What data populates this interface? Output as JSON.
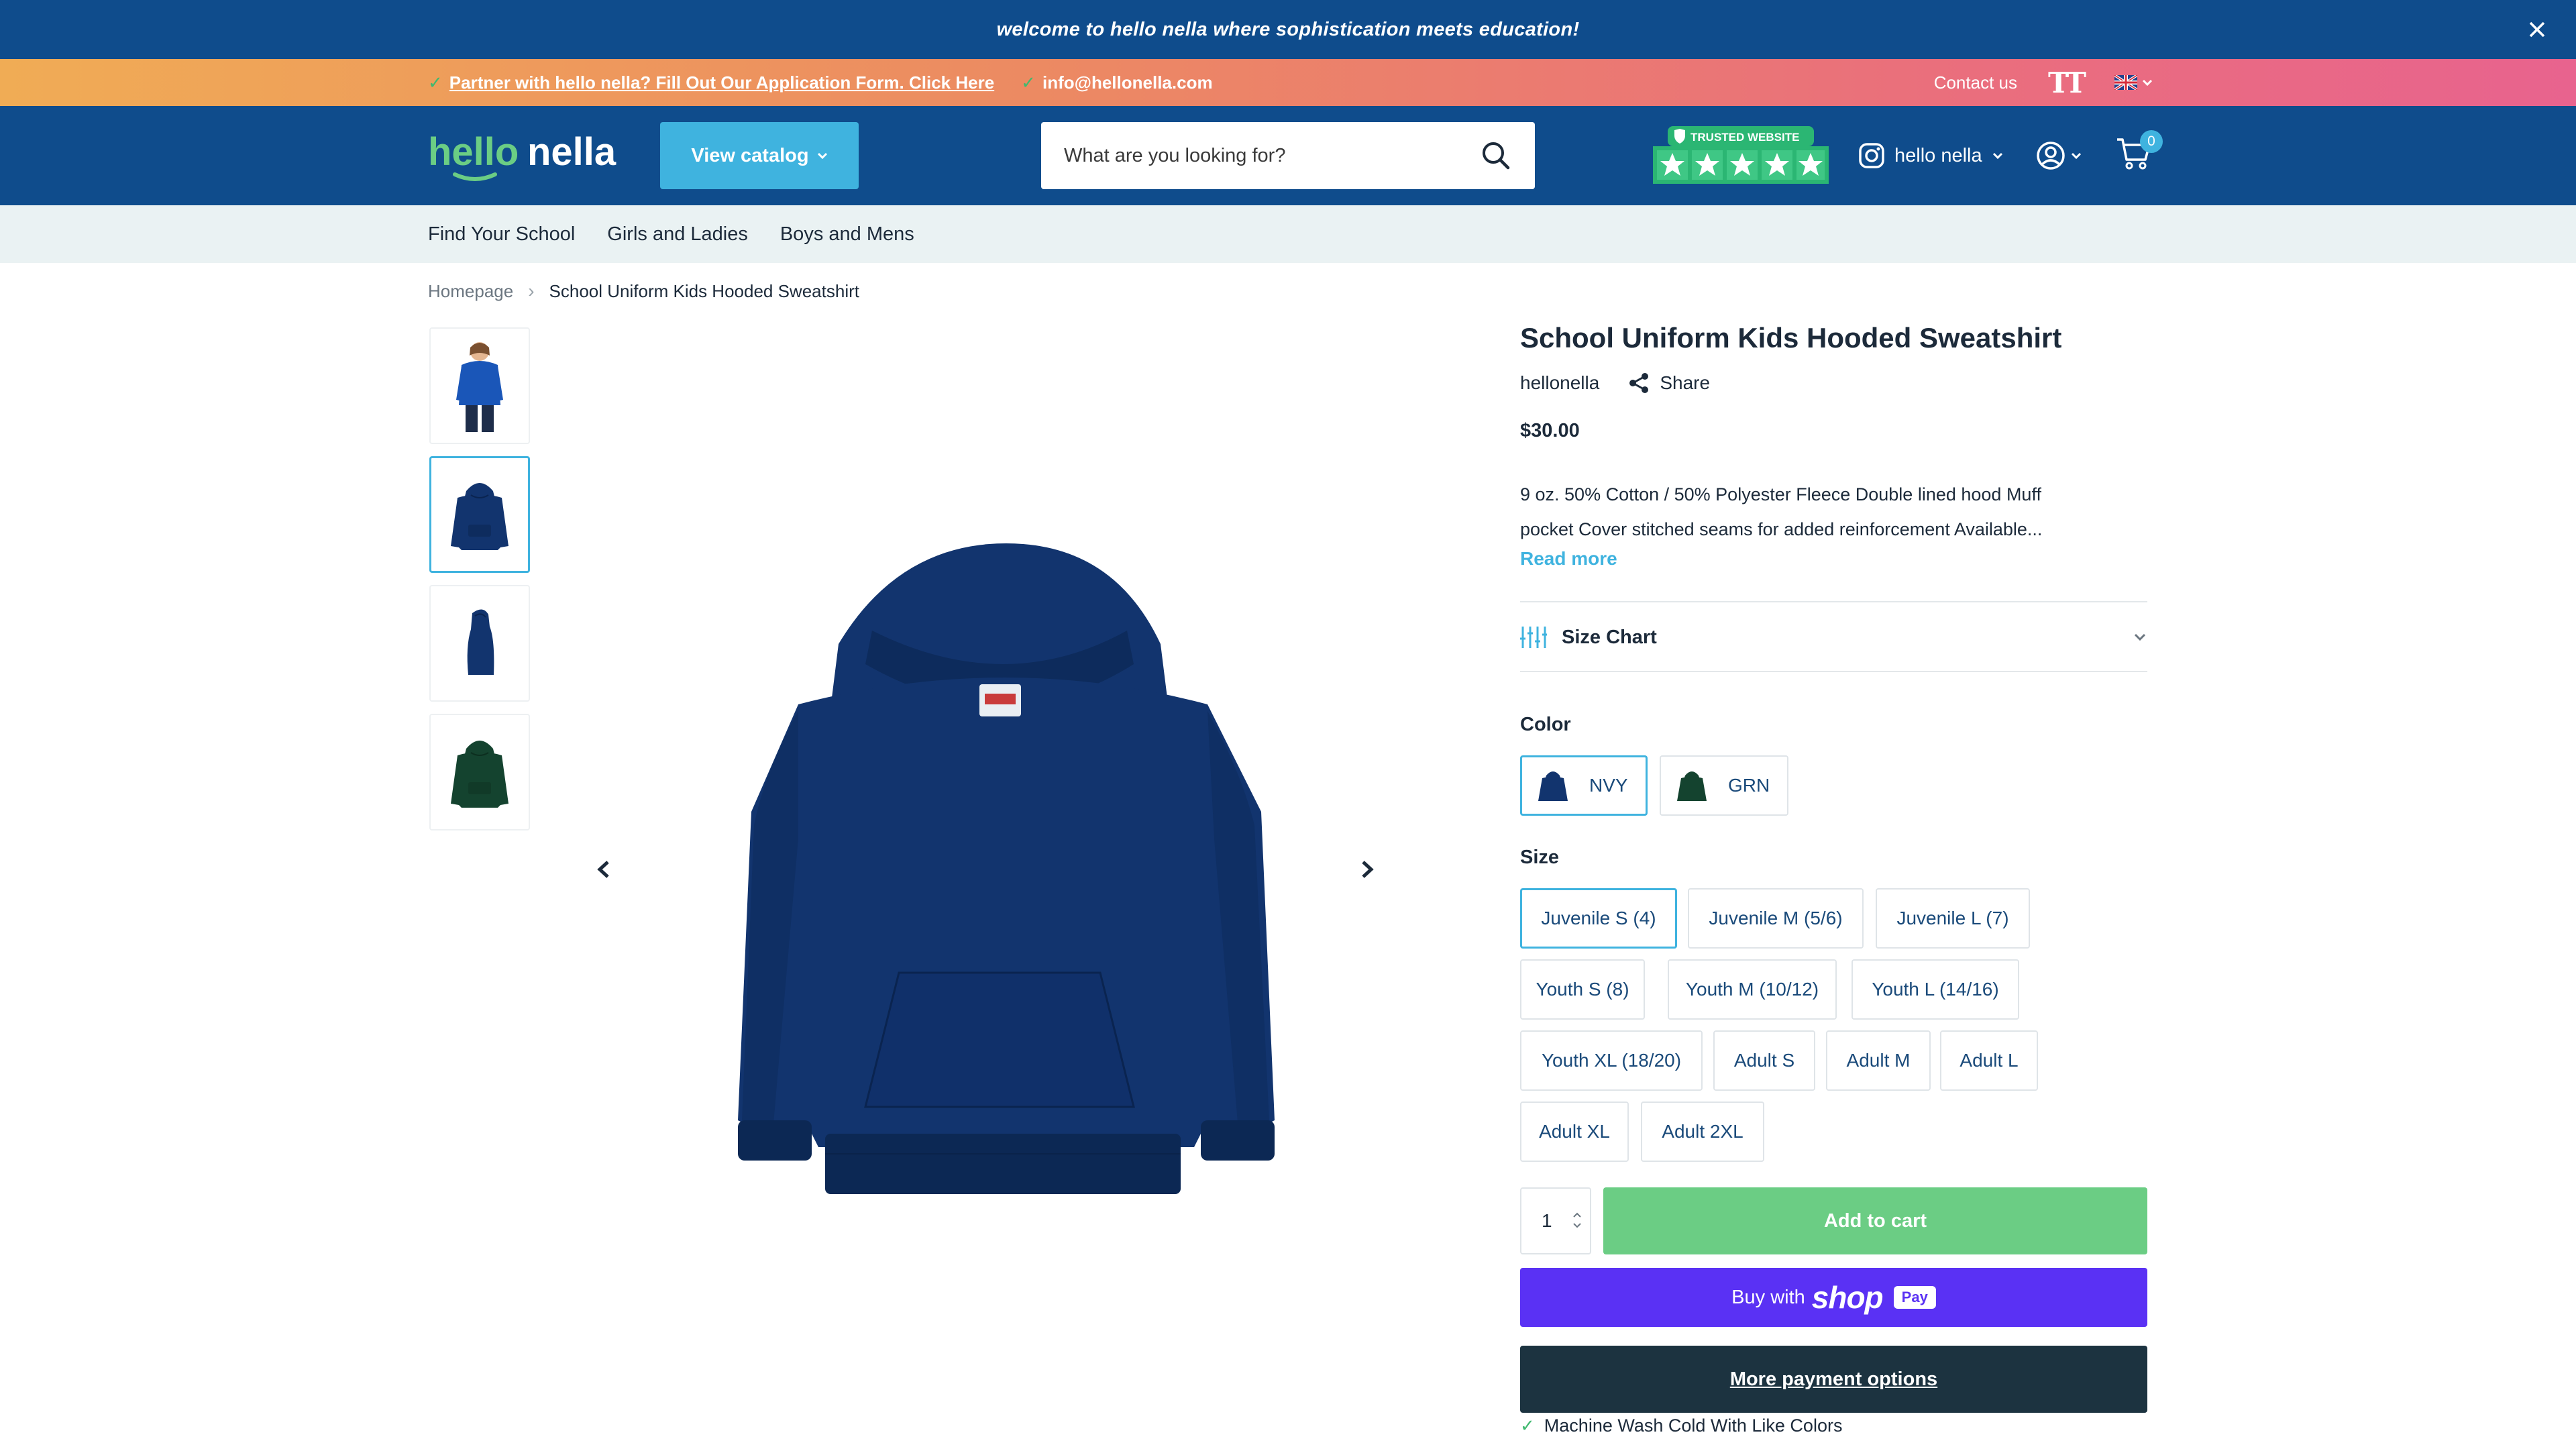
{
  "announcement": {
    "text": "welcome to hello nella where sophistication meets education!"
  },
  "promo": {
    "partner_link": "Partner with hello nella? Fill Out Our Application Form. Click Here",
    "email": "info@hellonella.com",
    "contact": "Contact us"
  },
  "header": {
    "logo_text_1": "hello",
    "logo_text_2": "nella",
    "catalog_label": "View catalog",
    "search_placeholder": "What are you looking for?",
    "trusted_label": "TRUSTED WEBSITE",
    "instagram_label": "hello nella",
    "cart_count": "0"
  },
  "nav": {
    "items": [
      "Find Your School",
      "Girls and Ladies",
      "Boys and Mens"
    ]
  },
  "breadcrumb": {
    "home": "Homepage",
    "current": "School Uniform Kids Hooded Sweatshirt"
  },
  "product": {
    "title": "School Uniform Kids Hooded Sweatshirt",
    "vendor": "hellonella",
    "share_label": "Share",
    "price": "$30.00",
    "description_line1": "9 oz. 50% Cotton / 50% Polyester Fleece Double lined hood Muff",
    "description_line2": "pocket Cover stitched seams for added reinforcement Available...",
    "read_more": "Read more",
    "size_chart_label": "Size Chart",
    "color_label": "Color",
    "colors": [
      {
        "label": "NVY",
        "hex": "#12346e"
      },
      {
        "label": "GRN",
        "hex": "#14432f"
      }
    ],
    "size_label": "Size",
    "sizes": [
      "Juvenile S (4)",
      "Juvenile M (5/6)",
      "Juvenile L (7)",
      "Youth S (8)",
      "Youth M (10/12)",
      "Youth L (14/16)",
      "Youth XL (18/20)",
      "Adult S",
      "Adult M",
      "Adult L",
      "Adult XL",
      "Adult 2XL"
    ],
    "quantity": "1",
    "add_to_cart": "Add to cart",
    "buy_with": "Buy with",
    "shop_word": "shop",
    "pay_word": "Pay",
    "more_payment": "More payment options",
    "care_note": "Machine Wash Cold With Like Colors"
  },
  "colors": {
    "brand_blue": "#0f4c8c",
    "accent_cyan": "#3fb3df",
    "add_cart_green": "#6bcd84",
    "shoppay_purple": "#5a31f4"
  }
}
